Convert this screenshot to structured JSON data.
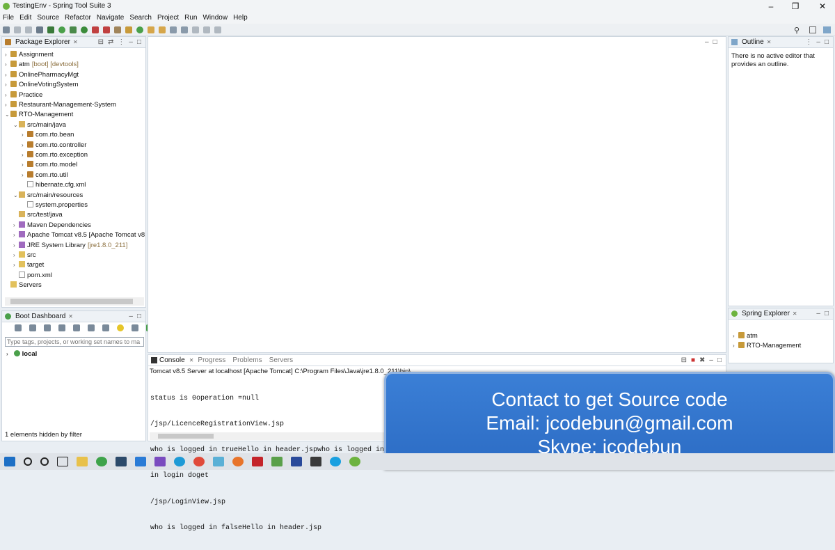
{
  "window": {
    "title": "TestingEnv - Spring Tool Suite 3"
  },
  "menu": [
    "File",
    "Edit",
    "Source",
    "Refactor",
    "Navigate",
    "Search",
    "Project",
    "Run",
    "Window",
    "Help"
  ],
  "package_explorer": {
    "title": "Package Explorer",
    "items": [
      {
        "label": "Assignment",
        "extra": ""
      },
      {
        "label": "atm",
        "extra": "[boot] [devtools]"
      },
      {
        "label": "OnlinePharmacyMgt",
        "extra": ""
      },
      {
        "label": "OnlineVotingSystem",
        "extra": ""
      },
      {
        "label": "Practice",
        "extra": ""
      },
      {
        "label": "Restaurant-Management-System",
        "extra": ""
      },
      {
        "label": "RTO-Management",
        "extra": ""
      },
      {
        "label": "src/main/java",
        "extra": ""
      },
      {
        "label": "com.rto.bean",
        "extra": ""
      },
      {
        "label": "com.rto.controller",
        "extra": ""
      },
      {
        "label": "com.rto.exception",
        "extra": ""
      },
      {
        "label": "com.rto.model",
        "extra": ""
      },
      {
        "label": "com.rto.util",
        "extra": ""
      },
      {
        "label": "hibernate.cfg.xml",
        "extra": ""
      },
      {
        "label": "src/main/resources",
        "extra": ""
      },
      {
        "label": "system.properties",
        "extra": ""
      },
      {
        "label": "src/test/java",
        "extra": ""
      },
      {
        "label": "Maven Dependencies",
        "extra": ""
      },
      {
        "label": "Apache Tomcat v8.5 [Apache Tomcat v8",
        "extra": ""
      },
      {
        "label": "JRE System Library",
        "extra": "[jre1.8.0_211]"
      },
      {
        "label": "src",
        "extra": ""
      },
      {
        "label": "target",
        "extra": ""
      },
      {
        "label": "pom.xml",
        "extra": ""
      },
      {
        "label": "Servers",
        "extra": ""
      }
    ]
  },
  "boot_dashboard": {
    "title": "Boot Dashboard",
    "filter_placeholder": "Type tags, projects, or working set names to ma",
    "local_label": "local",
    "status": "1 elements hidden by filter"
  },
  "outline": {
    "title": "Outline",
    "message": "There is no active editor that provides an outline."
  },
  "spring_explorer": {
    "title": "Spring Explorer",
    "items": [
      "atm",
      "RTO-Management"
    ]
  },
  "console": {
    "tabs": [
      "Console",
      "Progress",
      "Problems",
      "Servers"
    ],
    "header": "Tomcat v8.5 Server at localhost [Apache Tomcat] C:\\Program Files\\Java\\jre1.8.0_211\\bin\\",
    "lines": [
      "status is 0operation =null",
      "/jsp/LicenceRegistrationView.jsp",
      "who is logged in trueHello in header.jspwho is logged in tru",
      "in login doget",
      "/jsp/LoginView.jsp",
      "who is logged in falseHello in header.jsp"
    ]
  },
  "banner": {
    "line1": "Contact to get Source code",
    "line2": "Email: jcodebun@gmail.com",
    "line3": "Skype: jcodebun"
  }
}
